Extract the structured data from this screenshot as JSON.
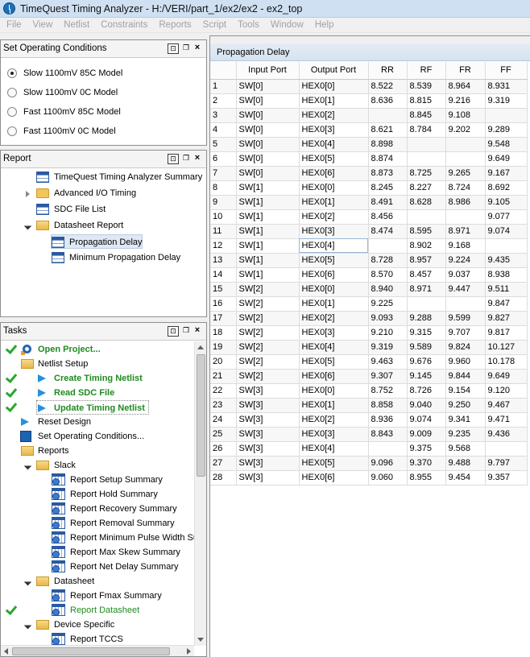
{
  "window": {
    "title": "TimeQuest Timing Analyzer - H:/VERI/part_1/ex2/ex2 - ex2_top"
  },
  "menu": [
    "File",
    "View",
    "Netlist",
    "Constraints",
    "Reports",
    "Script",
    "Tools",
    "Window",
    "Help"
  ],
  "operating_conditions": {
    "title": "Set Operating Conditions",
    "options": [
      {
        "label": "Slow 1100mV 85C Model",
        "selected": true
      },
      {
        "label": "Slow 1100mV 0C Model",
        "selected": false
      },
      {
        "label": "Fast 1100mV 85C Model",
        "selected": false
      },
      {
        "label": "Fast 1100mV 0C Model",
        "selected": false
      }
    ]
  },
  "report": {
    "title": "Report",
    "items": [
      {
        "label": "TimeQuest Timing Analyzer Summary",
        "icon": "table-icon"
      },
      {
        "label": "Advanced I/O Timing",
        "icon": "folder-icon"
      },
      {
        "label": "SDC File List",
        "icon": "table-icon"
      },
      {
        "label": "Datasheet Report",
        "icon": "folder-open-icon"
      },
      {
        "label": "Propagation Delay",
        "icon": "table-icon"
      },
      {
        "label": "Minimum Propagation Delay",
        "icon": "table-icon"
      }
    ]
  },
  "tasks": {
    "title": "Tasks",
    "items": [
      {
        "label": "Open Project..."
      },
      {
        "label": "Netlist Setup"
      },
      {
        "label": "Create Timing Netlist"
      },
      {
        "label": "Read SDC File"
      },
      {
        "label": "Update Timing Netlist"
      },
      {
        "label": "Reset Design"
      },
      {
        "label": "Set Operating Conditions..."
      },
      {
        "label": "Reports"
      },
      {
        "label": "Slack"
      },
      {
        "label": "Report Setup Summary"
      },
      {
        "label": "Report Hold Summary"
      },
      {
        "label": "Report Recovery Summary"
      },
      {
        "label": "Report Removal Summary"
      },
      {
        "label": "Report Minimum Pulse Width Su"
      },
      {
        "label": "Report Max Skew Summary"
      },
      {
        "label": "Report Net Delay Summary"
      },
      {
        "label": "Datasheet"
      },
      {
        "label": "Report Fmax Summary"
      },
      {
        "label": "Report Datasheet"
      },
      {
        "label": "Device Specific"
      },
      {
        "label": "Report TCCS"
      }
    ]
  },
  "propagation": {
    "title": "Propagation Delay",
    "headers": [
      "Input Port",
      "Output Port",
      "RR",
      "RF",
      "FR",
      "FF"
    ],
    "rows": [
      [
        "1",
        "SW[0]",
        "HEX0[0]",
        "8.522",
        "8.539",
        "8.964",
        "8.931"
      ],
      [
        "2",
        "SW[0]",
        "HEX0[1]",
        "8.636",
        "8.815",
        "9.216",
        "9.319"
      ],
      [
        "3",
        "SW[0]",
        "HEX0[2]",
        "",
        "8.845",
        "9.108",
        ""
      ],
      [
        "4",
        "SW[0]",
        "HEX0[3]",
        "8.621",
        "8.784",
        "9.202",
        "9.289"
      ],
      [
        "5",
        "SW[0]",
        "HEX0[4]",
        "8.898",
        "",
        "",
        "9.548"
      ],
      [
        "6",
        "SW[0]",
        "HEX0[5]",
        "8.874",
        "",
        "",
        "9.649"
      ],
      [
        "7",
        "SW[0]",
        "HEX0[6]",
        "8.873",
        "8.725",
        "9.265",
        "9.167"
      ],
      [
        "8",
        "SW[1]",
        "HEX0[0]",
        "8.245",
        "8.227",
        "8.724",
        "8.692"
      ],
      [
        "9",
        "SW[1]",
        "HEX0[1]",
        "8.491",
        "8.628",
        "8.986",
        "9.105"
      ],
      [
        "10",
        "SW[1]",
        "HEX0[2]",
        "8.456",
        "",
        "",
        "9.077"
      ],
      [
        "11",
        "SW[1]",
        "HEX0[3]",
        "8.474",
        "8.595",
        "8.971",
        "9.074"
      ],
      [
        "12",
        "SW[1]",
        "HEX0[4]",
        "",
        "8.902",
        "9.168",
        ""
      ],
      [
        "13",
        "SW[1]",
        "HEX0[5]",
        "8.728",
        "8.957",
        "9.224",
        "9.435"
      ],
      [
        "14",
        "SW[1]",
        "HEX0[6]",
        "8.570",
        "8.457",
        "9.037",
        "8.938"
      ],
      [
        "15",
        "SW[2]",
        "HEX0[0]",
        "8.940",
        "8.971",
        "9.447",
        "9.511"
      ],
      [
        "16",
        "SW[2]",
        "HEX0[1]",
        "9.225",
        "",
        "",
        "9.847"
      ],
      [
        "17",
        "SW[2]",
        "HEX0[2]",
        "9.093",
        "9.288",
        "9.599",
        "9.827"
      ],
      [
        "18",
        "SW[2]",
        "HEX0[3]",
        "9.210",
        "9.315",
        "9.707",
        "9.817"
      ],
      [
        "19",
        "SW[2]",
        "HEX0[4]",
        "9.319",
        "9.589",
        "9.824",
        "10.127"
      ],
      [
        "20",
        "SW[2]",
        "HEX0[5]",
        "9.463",
        "9.676",
        "9.960",
        "10.178"
      ],
      [
        "21",
        "SW[2]",
        "HEX0[6]",
        "9.307",
        "9.145",
        "9.844",
        "9.649"
      ],
      [
        "22",
        "SW[3]",
        "HEX0[0]",
        "8.752",
        "8.726",
        "9.154",
        "9.120"
      ],
      [
        "23",
        "SW[3]",
        "HEX0[1]",
        "8.858",
        "9.040",
        "9.250",
        "9.467"
      ],
      [
        "24",
        "SW[3]",
        "HEX0[2]",
        "8.936",
        "9.074",
        "9.341",
        "9.471"
      ],
      [
        "25",
        "SW[3]",
        "HEX0[3]",
        "8.843",
        "9.009",
        "9.235",
        "9.436"
      ],
      [
        "26",
        "SW[3]",
        "HEX0[4]",
        "",
        "9.375",
        "9.568",
        ""
      ],
      [
        "27",
        "SW[3]",
        "HEX0[5]",
        "9.096",
        "9.370",
        "9.488",
        "9.797"
      ],
      [
        "28",
        "SW[3]",
        "HEX0[6]",
        "9.060",
        "8.955",
        "9.454",
        "9.357"
      ]
    ]
  }
}
